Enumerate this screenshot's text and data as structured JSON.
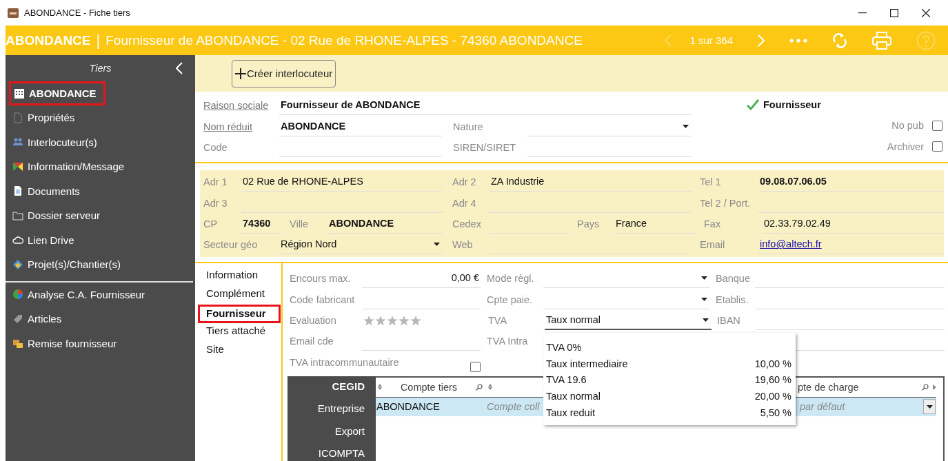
{
  "window": {
    "title": "ABONDANCE - Fiche tiers"
  },
  "header": {
    "name": "ABONDANCE",
    "separator": "|",
    "subtitle": "Fournisseur de ABONDANCE - 02 Rue de RHONE-ALPES - 74360 ABONDANCE",
    "pager": "1 sur 364",
    "prev_disabled": true,
    "help_disabled": true
  },
  "sidebar": {
    "title": "Tiers",
    "sections": [
      [
        {
          "label": "ABONDANCE",
          "kind": "building",
          "selected": true
        },
        {
          "label": "Propriétés",
          "kind": "page",
          "selected": false
        },
        {
          "label": "Interlocuteur(s)",
          "kind": "people",
          "selected": false
        },
        {
          "label": "Information/Message",
          "kind": "flag",
          "selected": false
        },
        {
          "label": "Documents",
          "kind": "document",
          "selected": false
        },
        {
          "label": "Dossier serveur",
          "kind": "folder",
          "selected": false
        },
        {
          "label": "Lien Drive",
          "kind": "cloud",
          "selected": false
        },
        {
          "label": "Projet(s)/Chantier(s)",
          "kind": "diamond",
          "selected": false
        }
      ],
      [
        {
          "label": "Analyse C.A. Fournisseur",
          "kind": "pie",
          "selected": false
        },
        {
          "label": "Articles",
          "kind": "tag",
          "selected": false
        },
        {
          "label": "Remise fournisseur",
          "kind": "boxes",
          "selected": false
        }
      ]
    ]
  },
  "toolbar": {
    "button": "Créer interlocuteur"
  },
  "identity": {
    "raison_sociale": {
      "label": "Raison sociale",
      "value": "Fournisseur de ABONDANCE"
    },
    "nom_reduit": {
      "label": "Nom réduit",
      "value": "ABONDANCE"
    },
    "nature": {
      "label": "Nature"
    },
    "code": {
      "label": "Code"
    },
    "siren": {
      "label": "SIREN/SIRET"
    },
    "status": {
      "label": "Fournisseur",
      "checked": true
    },
    "options": [
      {
        "label": "No pub",
        "checked": false
      },
      {
        "label": "Archiver",
        "checked": false
      }
    ]
  },
  "address": {
    "adr1": {
      "label": "Adr 1",
      "value": "02 Rue de RHONE-ALPES"
    },
    "adr2": {
      "label": "Adr 2",
      "value": "ZA Industrie"
    },
    "tel1": {
      "label": "Tel 1",
      "value": "09.08.07.06.05"
    },
    "adr3": {
      "label": "Adr 3"
    },
    "adr4": {
      "label": "Adr 4"
    },
    "tel2": {
      "label": "Tel 2 / Port."
    },
    "cp": {
      "label": "CP",
      "value": "74360"
    },
    "ville": {
      "label": "Ville",
      "value": "ABONDANCE"
    },
    "cedex": {
      "label": "Cedex"
    },
    "pays": {
      "label": "Pays",
      "value": "France"
    },
    "fax": {
      "label": "Fax",
      "value": "02.33.79.02.49"
    },
    "secteur": {
      "label": "Secteur géo",
      "value": "Région Nord"
    },
    "web": {
      "label": "Web"
    },
    "email": {
      "label": "Email",
      "value": "info@altech.fr"
    }
  },
  "tabs": [
    {
      "label": "Information",
      "selected": false
    },
    {
      "label": "Complément",
      "selected": false
    },
    {
      "label": "Fournisseur",
      "selected": true
    },
    {
      "label": "Tiers attaché",
      "selected": false
    },
    {
      "label": "Site",
      "selected": false
    }
  ],
  "supplier": {
    "encours": {
      "label": "Encours max.",
      "value": "0,00 €"
    },
    "mode": {
      "label": "Mode règl."
    },
    "banque": {
      "label": "Banque"
    },
    "code_fab": {
      "label": "Code fabricant"
    },
    "cpte": {
      "label": "Cpte paie."
    },
    "etablis": {
      "label": "Etablis."
    },
    "evaluation": {
      "label": "Evaluation",
      "stars": 0
    },
    "tva": {
      "label": "TVA",
      "value": "Taux normal",
      "expanded": true
    },
    "iban": {
      "label": "IBAN"
    },
    "email_cde": {
      "label": "Email cde"
    },
    "tva_intra": {
      "label": "TVA Intra"
    },
    "intracom": {
      "label": "TVA intracommunautaire",
      "checked": false
    }
  },
  "tva_options": [
    {
      "label": "TVA 0%"
    },
    {
      "label": "Taux intermediaire",
      "rate": "10,00 %"
    },
    {
      "label": "TVA 19.6",
      "rate": "19,60 %"
    },
    {
      "label": "Taux normal",
      "rate": "20,00 %"
    },
    {
      "label": "Taux reduit",
      "rate": "5,50 %"
    }
  ],
  "accounting": {
    "systems": [
      {
        "label": "CEGID",
        "selected": true
      },
      {
        "label": "Entreprise",
        "selected": false
      },
      {
        "label": "Export",
        "selected": false
      },
      {
        "label": "ICOMPTA",
        "selected": false
      }
    ],
    "columns": [
      "Compte tiers",
      "",
      "pte de charge"
    ],
    "rows": [
      {
        "cells": [
          "ABONDANCE",
          "Compte coll",
          "par défaut"
        ],
        "selected": true
      }
    ]
  }
}
